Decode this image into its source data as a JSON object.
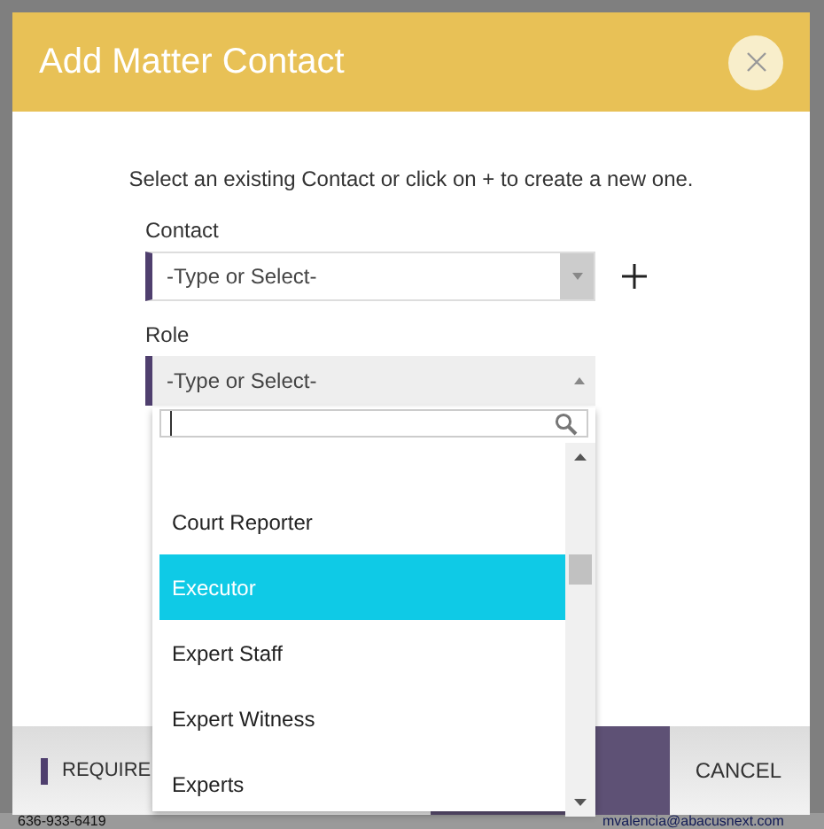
{
  "dialog": {
    "title": "Add Matter Contact",
    "instruction": "Select an existing Contact or click on + to create a new one.",
    "contact": {
      "label": "Contact",
      "placeholder": "-Type or Select-"
    },
    "role": {
      "label": "Role",
      "placeholder": "-Type or Select-",
      "expanded": true,
      "options": [
        {
          "label": "Court Reporter",
          "selected": false
        },
        {
          "label": "Executor",
          "selected": true
        },
        {
          "label": "Expert Staff",
          "selected": false
        },
        {
          "label": "Expert Witness",
          "selected": false
        },
        {
          "label": "Experts",
          "selected": false
        }
      ]
    },
    "footer": {
      "required_note": "REQUIRE",
      "cancel": "CANCEL"
    }
  },
  "background": {
    "phone": "636-933-6419",
    "email": "mvalencia@abacusnext.com"
  }
}
